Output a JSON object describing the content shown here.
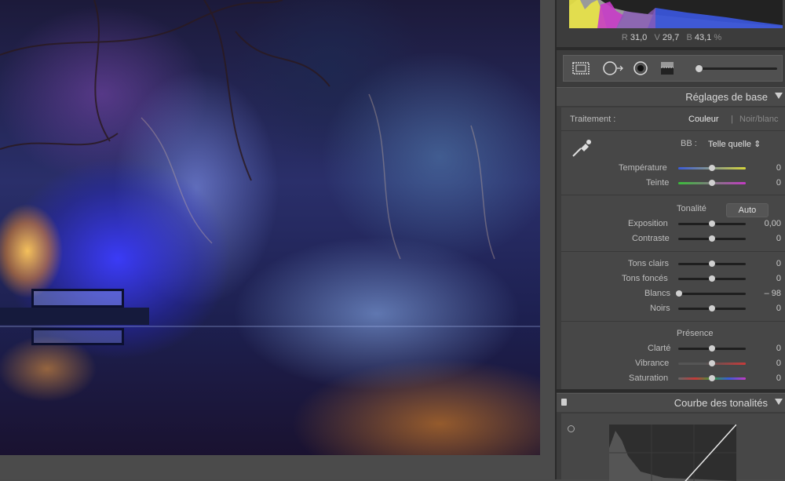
{
  "histogram": {
    "readout": {
      "r_label": "R",
      "r_value": "31,0",
      "v_label": "V",
      "v_value": "29,7",
      "b_label": "B",
      "b_value": "43,1",
      "unit": "%"
    }
  },
  "basic": {
    "title": "Réglages de base",
    "treatment_label": "Traitement :",
    "color_option": "Couleur",
    "bw_option": "Noir/blanc",
    "wb_label": "BB :",
    "wb_value": "Telle quelle",
    "wb_arrow": "⇕",
    "temperature": {
      "label": "Température",
      "value": "0",
      "level": 0.5
    },
    "tint": {
      "label": "Teinte",
      "value": "0",
      "level": 0.5
    },
    "tone_label": "Tonalité",
    "auto_label": "Auto",
    "exposure": {
      "label": "Exposition",
      "value": "0,00",
      "level": 0.5
    },
    "contrast": {
      "label": "Contraste",
      "value": "0",
      "level": 0.5
    },
    "highlights": {
      "label": "Tons clairs",
      "value": "0",
      "level": 0.5
    },
    "shadows": {
      "label": "Tons foncés",
      "value": "0",
      "level": 0.5
    },
    "whites": {
      "label": "Blancs",
      "value": "– 98",
      "level": 0.01
    },
    "blacks": {
      "label": "Noirs",
      "value": "0",
      "level": 0.5
    },
    "presence_label": "Présence",
    "clarity": {
      "label": "Clarté",
      "value": "0",
      "level": 0.5
    },
    "vibrance": {
      "label": "Vibrance",
      "value": "0",
      "level": 0.5
    },
    "saturation": {
      "label": "Saturation",
      "value": "0",
      "level": 0.5
    }
  },
  "tone_curve": {
    "title": "Courbe des tonalités"
  },
  "colors": {
    "panel_bg": "#3c3c3c",
    "section_bg": "#474747",
    "text": "#bdbdbd"
  }
}
